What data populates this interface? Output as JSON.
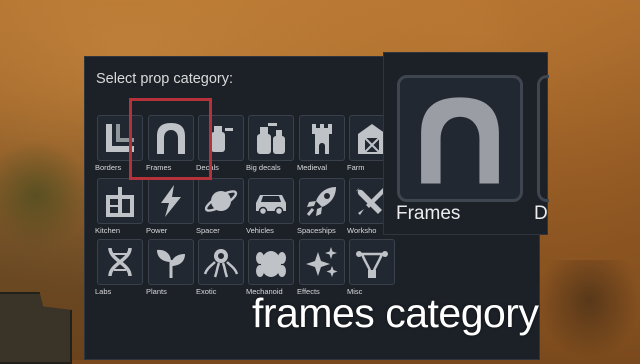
{
  "panel": {
    "title": "Select prop category:",
    "categories": [
      {
        "label": "Borders",
        "icon": "borders-icon"
      },
      {
        "label": "Frames",
        "icon": "frames-arch-icon"
      },
      {
        "label": "Decals",
        "icon": "decals-icon"
      },
      {
        "label": "Big decals",
        "icon": "big-decals-icon"
      },
      {
        "label": "Medieval",
        "icon": "castle-tower-icon"
      },
      {
        "label": "Farm",
        "icon": "barn-icon"
      },
      {
        "label": "Kitchen",
        "icon": "kitchen-icon"
      },
      {
        "label": "Power",
        "icon": "lightning-icon"
      },
      {
        "label": "Spacer",
        "icon": "planet-icon"
      },
      {
        "label": "Vehicles",
        "icon": "car-icon"
      },
      {
        "label": "Spaceships",
        "icon": "rocket-icon"
      },
      {
        "label": "Worksho",
        "icon": "wrench-screwdriver-icon"
      },
      {
        "label": "Labs",
        "icon": "dna-icon"
      },
      {
        "label": "Plants",
        "icon": "sprout-icon"
      },
      {
        "label": "Exotic",
        "icon": "tentacle-creature-icon"
      },
      {
        "label": "Mechanoid",
        "icon": "mechanoid-icon"
      },
      {
        "label": "Effects",
        "icon": "sparkles-icon"
      },
      {
        "label": "Misc",
        "icon": "vector-path-icon"
      }
    ]
  },
  "preview": {
    "label": "Frames",
    "next_label": "D"
  },
  "caption": "frames category",
  "colors": {
    "panel_bg": "#1c2128",
    "highlight": "#b5323a",
    "icon": "#bfc3c8"
  }
}
